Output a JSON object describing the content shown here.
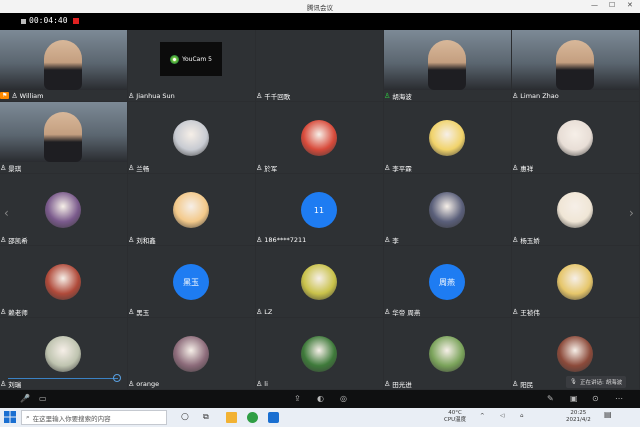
{
  "window": {
    "title": "腾讯会议"
  },
  "meeting": {
    "elapsed": "00:04:40",
    "speaking_label": "正在讲话: 胡海波"
  },
  "participants": [
    {
      "name": "William",
      "kind": "video",
      "host": true
    },
    {
      "name": "Jianhua Sun",
      "kind": "logo",
      "logo_text": "YouCam 5"
    },
    {
      "name": "千千回歌",
      "kind": "empty"
    },
    {
      "name": "胡海波",
      "kind": "video",
      "speaking": true
    },
    {
      "name": "Liman Zhao",
      "kind": "video"
    },
    {
      "name": "景琪",
      "kind": "video"
    },
    {
      "name": "兰畅",
      "kind": "avatar",
      "color": "#c8cbd2"
    },
    {
      "name": "於军",
      "kind": "avatar",
      "color": "#d84a3a"
    },
    {
      "name": "李平霖",
      "kind": "avatar",
      "color": "#f1d36a"
    },
    {
      "name": "惠祥",
      "kind": "avatar",
      "color": "#e8ded6"
    },
    {
      "name": "邵凯希",
      "kind": "avatar",
      "color": "#7a5a8c"
    },
    {
      "name": "刘和鑫",
      "kind": "avatar",
      "color": "#f3c98a"
    },
    {
      "name": "186****7211",
      "kind": "letter",
      "text": "11"
    },
    {
      "name": "李",
      "kind": "avatar",
      "color": "#5a5f7a"
    },
    {
      "name": "杨玉娇",
      "kind": "avatar",
      "color": "#f0e6d6"
    },
    {
      "name": "赖老师",
      "kind": "avatar",
      "color": "#b04a3a"
    },
    {
      "name": "黑玉",
      "kind": "letter",
      "text": "黑玉"
    },
    {
      "name": "LZ",
      "kind": "avatar",
      "color": "#c9c24a"
    },
    {
      "name": "华帝  周燕",
      "kind": "letter",
      "text": "周燕"
    },
    {
      "name": "王祯伟",
      "kind": "avatar",
      "color": "#e6c66a"
    },
    {
      "name": "刘瑞",
      "kind": "avatar",
      "color": "#bfc4b0"
    },
    {
      "name": "orange",
      "kind": "avatar",
      "color": "#8c6b7a"
    },
    {
      "name": "li",
      "kind": "avatar",
      "color": "#3e7a3a"
    },
    {
      "name": "田光进",
      "kind": "avatar",
      "color": "#7aa35a"
    },
    {
      "name": "阳民",
      "kind": "avatar",
      "color": "#8c4a3a"
    }
  ],
  "taskbar": {
    "search_placeholder": "在这里输入你要搜索的内容",
    "temperature": "40°C",
    "cpu_label": "CPU温度",
    "time": "20:25",
    "date": "2021/4/2"
  }
}
